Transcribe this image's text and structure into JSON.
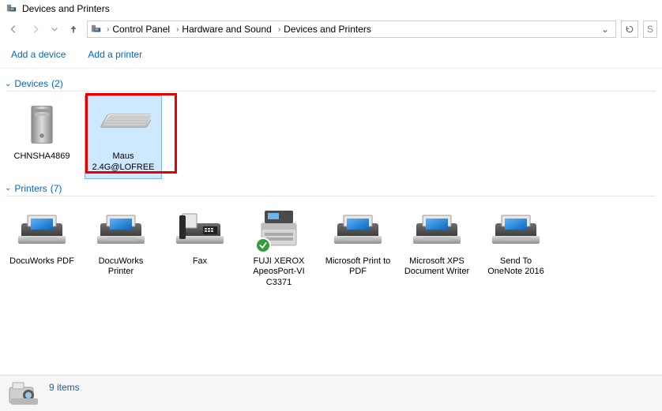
{
  "window": {
    "title": "Devices and Printers"
  },
  "breadcrumb": {
    "parts": [
      "Control Panel",
      "Hardware and Sound",
      "Devices and Printers"
    ]
  },
  "search_hint": "S",
  "commands": {
    "add_device": "Add a device",
    "add_printer": "Add a printer"
  },
  "groups": {
    "devices": {
      "label": "Devices",
      "count": "(2)",
      "items": [
        {
          "label": "CHNSHA4869",
          "type": "computer"
        },
        {
          "label": "Maus 2.4G@LOFREE",
          "type": "keyboard",
          "selected": true,
          "highlight": true
        }
      ]
    },
    "printers": {
      "label": "Printers",
      "count": "(7)",
      "items": [
        {
          "label": "DocuWorks PDF",
          "type": "printer"
        },
        {
          "label": "DocuWorks Printer",
          "type": "printer"
        },
        {
          "label": "Fax",
          "type": "fax"
        },
        {
          "label": "FUJI XEROX ApeosPort-VI C3371",
          "type": "mfp",
          "default": true
        },
        {
          "label": "Microsoft Print to PDF",
          "type": "printer"
        },
        {
          "label": "Microsoft XPS Document Writer",
          "type": "printer"
        },
        {
          "label": "Send To OneNote 2016",
          "type": "printer"
        }
      ]
    }
  },
  "status": {
    "text": "9 items"
  }
}
